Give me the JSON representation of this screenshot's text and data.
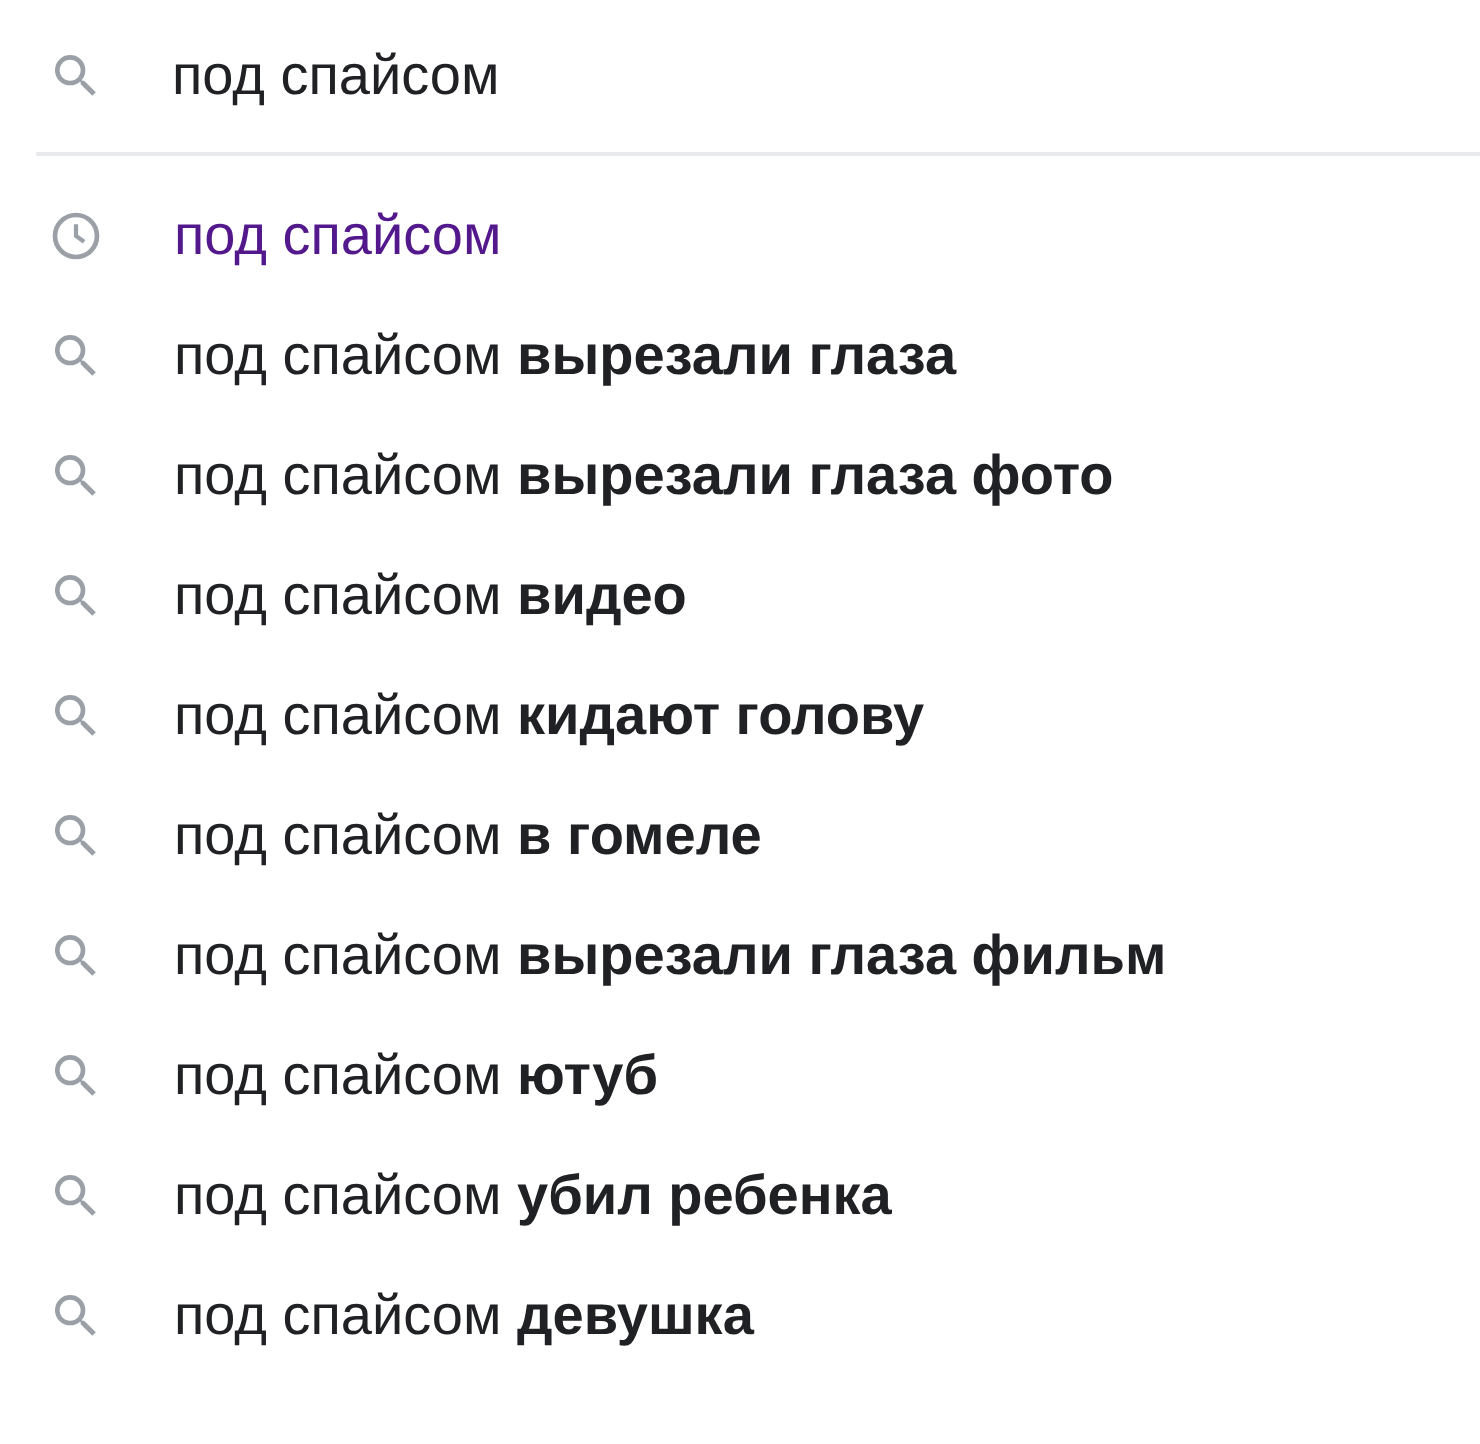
{
  "search": {
    "value": "под спайсом"
  },
  "suggestions": [
    {
      "kind": "history",
      "text": "под спайсом"
    },
    {
      "kind": "suggestion",
      "text": "под спайсом **вырезали глаза**"
    },
    {
      "kind": "suggestion",
      "text": "под спайсом **вырезали глаза фото**"
    },
    {
      "kind": "suggestion",
      "text": "под спайсом **видео**"
    },
    {
      "kind": "suggestion",
      "text": "под спайсом **кидают голову**"
    },
    {
      "kind": "suggestion",
      "text": "под спайсом **в гомеле**"
    },
    {
      "kind": "suggestion",
      "text": "под спайсом **вырезали глаза фильм**"
    },
    {
      "kind": "suggestion",
      "text": "под спайсом **ютуб**"
    },
    {
      "kind": "suggestion",
      "text": "под спайсом **убил ребенка**"
    },
    {
      "kind": "suggestion",
      "text": "под спайсом **девушка**"
    }
  ]
}
